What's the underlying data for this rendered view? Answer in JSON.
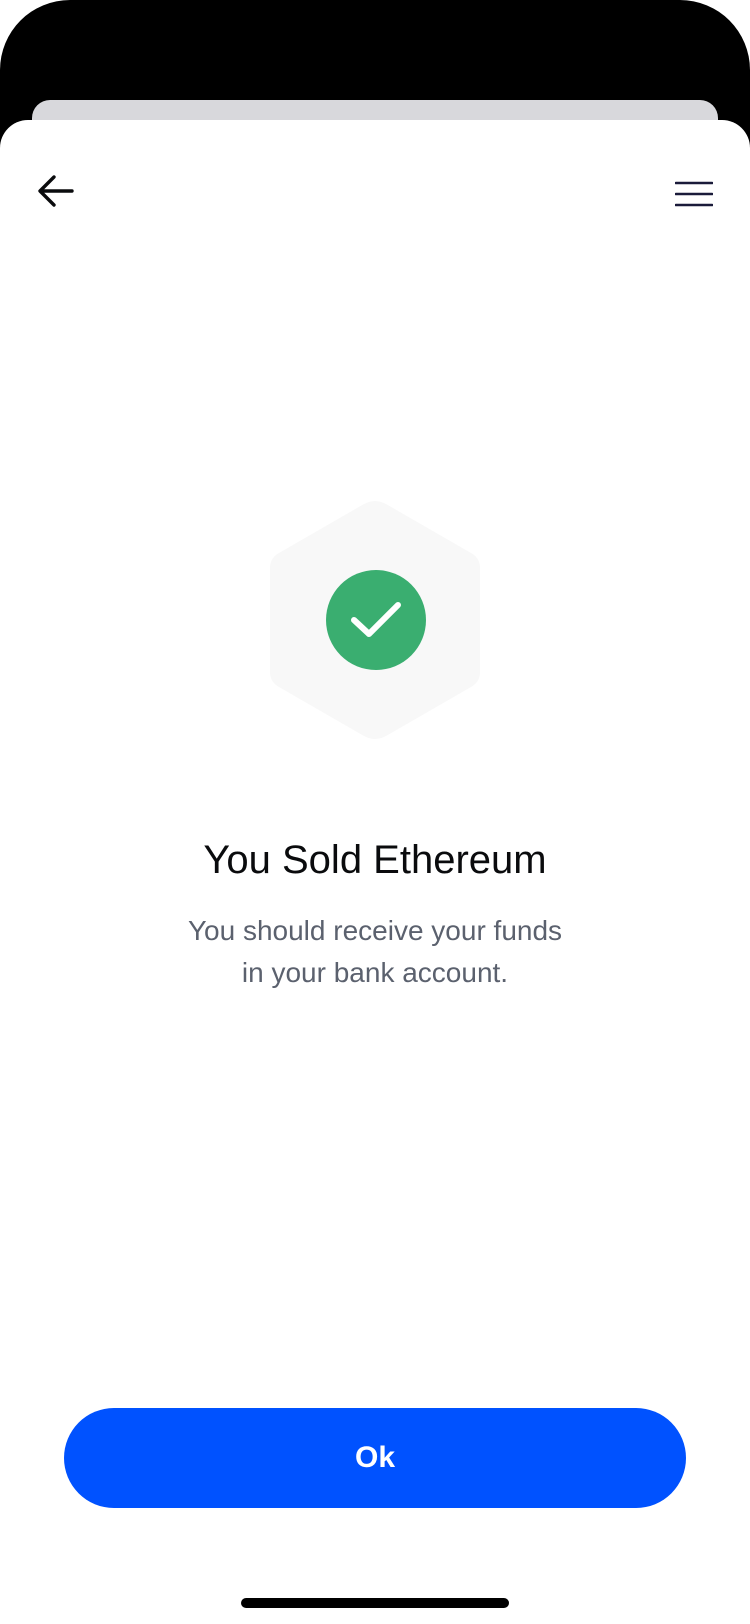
{
  "header": {
    "back_icon": "arrow-left-icon",
    "menu_icon": "hamburger-menu-icon"
  },
  "status": {
    "icon": "checkmark-icon",
    "badge_shape": "hexagon",
    "title": "You Sold Ethereum",
    "message_line1": "You should receive your funds",
    "message_line2": "in your bank account."
  },
  "actions": {
    "ok_label": "Ok"
  },
  "colors": {
    "primary_button": "#0052ff",
    "success_green": "#3aae70",
    "hexagon_fill": "#f8f8f8",
    "menu_icon": "#1a1b3a"
  }
}
